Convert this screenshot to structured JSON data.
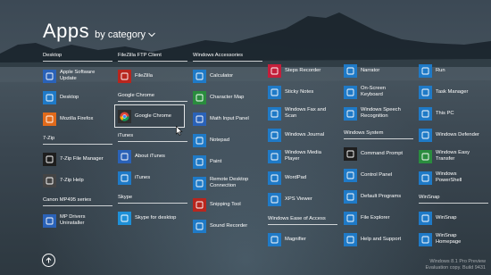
{
  "header": {
    "title": "Apps",
    "sort_label": "by category"
  },
  "columns": [
    {
      "groups": [
        {
          "name": "Desktop",
          "items": [
            {
              "label": "Apple Software\nUpdate",
              "icon": "apple-update-icon",
              "color": "#2a62b8"
            },
            {
              "label": "Desktop",
              "icon": "desktop-icon",
              "color": "#1f7ac7"
            },
            {
              "label": "Mozilla Firefox",
              "icon": "firefox-icon",
              "color": "#e06a1b"
            }
          ]
        },
        {
          "name": "7-Zip",
          "items": [
            {
              "label": "7-Zip File Manager",
              "icon": "7zip-icon",
              "color": "#1e1e1e"
            },
            {
              "label": "7-Zip Help",
              "icon": "help-file-icon",
              "color": "#444444"
            }
          ]
        },
        {
          "name": "Canon MP495 series",
          "items": [
            {
              "label": "MP Drivers\nUninstaller",
              "icon": "printer-icon",
              "color": "#2a62b8"
            }
          ]
        }
      ]
    },
    {
      "groups": [
        {
          "name": "FileZilla FTP Client",
          "items": [
            {
              "label": "FileZilla",
              "icon": "filezilla-icon",
              "color": "#b8261e"
            }
          ]
        },
        {
          "name": "Google Chrome",
          "items": [
            {
              "label": "Google Chrome",
              "icon": "chrome-icon",
              "color": "#2f2f2f",
              "highlight": true
            }
          ]
        },
        {
          "name": "iTunes",
          "items": [
            {
              "label": "About iTunes",
              "icon": "itunes-icon",
              "color": "#2a62b8"
            },
            {
              "label": "iTunes",
              "icon": "itunes-icon",
              "color": "#1f7ac7"
            }
          ]
        },
        {
          "name": "Skype",
          "items": [
            {
              "label": "Skype for desktop",
              "icon": "skype-icon",
              "color": "#1e90d8"
            }
          ]
        }
      ]
    },
    {
      "groups": [
        {
          "name": "Windows Accessories",
          "items": [
            {
              "label": "Calculator",
              "icon": "calculator-icon",
              "color": "#1f7ac7"
            },
            {
              "label": "Character Map",
              "icon": "character-map-icon",
              "color": "#2a8c3e"
            },
            {
              "label": "Math Input Panel",
              "icon": "math-input-icon",
              "color": "#2a62b8"
            },
            {
              "label": "Notepad",
              "icon": "notepad-icon",
              "color": "#1f7ac7"
            },
            {
              "label": "Paint",
              "icon": "paint-icon",
              "color": "#1f7ac7"
            },
            {
              "label": "Remote Desktop\nConnection",
              "icon": "remote-desktop-icon",
              "color": "#1f7ac7"
            },
            {
              "label": "Snipping Tool",
              "icon": "snipping-tool-icon",
              "color": "#b8261e"
            },
            {
              "label": "Sound Recorder",
              "icon": "sound-recorder-icon",
              "color": "#1f7ac7"
            }
          ]
        }
      ]
    },
    {
      "groups": [
        {
          "name": "",
          "items": [
            {
              "label": "Steps Recorder",
              "icon": "steps-recorder-icon",
              "color": "#c41f3b"
            },
            {
              "label": "Sticky Notes",
              "icon": "sticky-notes-icon",
              "color": "#1f7ac7"
            },
            {
              "label": "Windows Fax and\nScan",
              "icon": "fax-icon",
              "color": "#1f7ac7"
            },
            {
              "label": "Windows Journal",
              "icon": "journal-icon",
              "color": "#1f7ac7"
            },
            {
              "label": "Windows Media\nPlayer",
              "icon": "media-player-icon",
              "color": "#1f7ac7"
            },
            {
              "label": "WordPad",
              "icon": "wordpad-icon",
              "color": "#1f7ac7"
            },
            {
              "label": "XPS Viewer",
              "icon": "xps-viewer-icon",
              "color": "#1f7ac7"
            }
          ]
        },
        {
          "name": "Windows Ease of Access",
          "items": [
            {
              "label": "Magnifier",
              "icon": "magnifier-icon",
              "color": "#1f7ac7"
            }
          ]
        }
      ]
    },
    {
      "groups": [
        {
          "name": "",
          "items": [
            {
              "label": "Narrator",
              "icon": "narrator-icon",
              "color": "#1f7ac7"
            },
            {
              "label": "On-Screen\nKeyboard",
              "icon": "keyboard-icon",
              "color": "#1f7ac7"
            },
            {
              "label": "Windows Speech\nRecognition",
              "icon": "microphone-icon",
              "color": "#1f7ac7"
            }
          ]
        },
        {
          "name": "Windows System",
          "items": [
            {
              "label": "Command Prompt",
              "icon": "command-prompt-icon",
              "color": "#1e1e1e"
            },
            {
              "label": "Control Panel",
              "icon": "control-panel-icon",
              "color": "#1f7ac7"
            },
            {
              "label": "Default Programs",
              "icon": "default-programs-icon",
              "color": "#1f7ac7"
            },
            {
              "label": "File Explorer",
              "icon": "folder-icon",
              "color": "#1f7ac7"
            },
            {
              "label": "Help and Support",
              "icon": "help-icon",
              "color": "#1f7ac7"
            }
          ]
        }
      ]
    },
    {
      "groups": [
        {
          "name": "",
          "items": [
            {
              "label": "Run",
              "icon": "run-icon",
              "color": "#1f7ac7"
            },
            {
              "label": "Task Manager",
              "icon": "task-manager-icon",
              "color": "#1f7ac7"
            },
            {
              "label": "This PC",
              "icon": "this-pc-icon",
              "color": "#1f7ac7"
            },
            {
              "label": "Windows Defender",
              "icon": "defender-icon",
              "color": "#1f7ac7"
            },
            {
              "label": "Windows Easy\nTransfer",
              "icon": "easy-transfer-icon",
              "color": "#2a8c3e"
            },
            {
              "label": "Windows\nPowerShell",
              "icon": "powershell-icon",
              "color": "#1f7ac7"
            }
          ]
        },
        {
          "name": "WinSnap",
          "items": [
            {
              "label": "WinSnap",
              "icon": "winsnap-icon",
              "color": "#1f7ac7"
            },
            {
              "label": "WinSnap\nHomepage",
              "icon": "web-page-icon",
              "color": "#1f7ac7"
            }
          ]
        }
      ]
    }
  ],
  "watermark": {
    "line1": "Windows 8.1 Pro Preview",
    "line2": "Evaluation copy. Build 9431"
  }
}
